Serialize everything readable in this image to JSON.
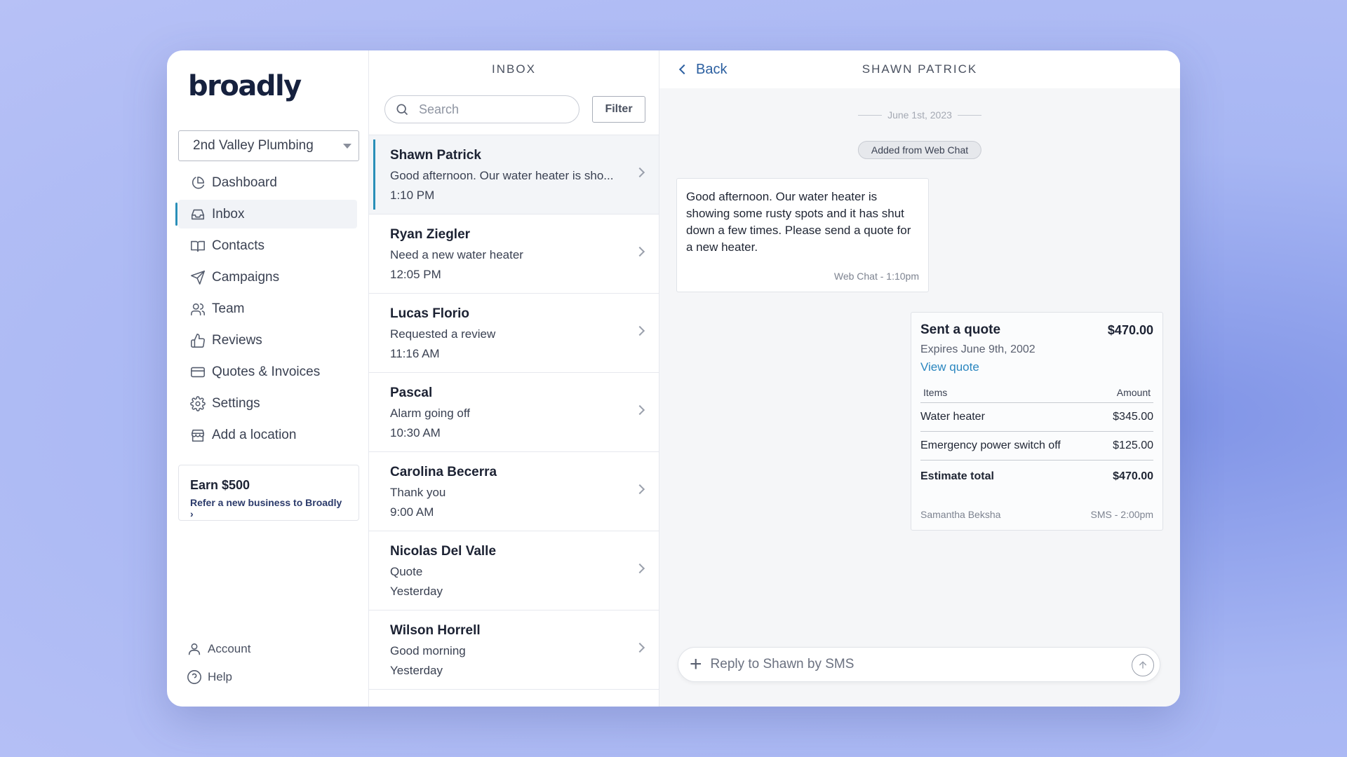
{
  "brand": {
    "logo_text": "broadly"
  },
  "sidebar": {
    "location": "2nd Valley Plumbing",
    "items": [
      {
        "label": "Dashboard",
        "icon": "pie-chart-icon"
      },
      {
        "label": "Inbox",
        "icon": "inbox-icon",
        "active": true
      },
      {
        "label": "Contacts",
        "icon": "book-icon"
      },
      {
        "label": "Campaigns",
        "icon": "send-icon"
      },
      {
        "label": "Team",
        "icon": "users-icon"
      },
      {
        "label": "Reviews",
        "icon": "thumbs-up-icon"
      },
      {
        "label": "Quotes & Invoices",
        "icon": "credit-card-icon"
      },
      {
        "label": "Settings",
        "icon": "gear-icon"
      },
      {
        "label": "Add a location",
        "icon": "store-icon"
      }
    ],
    "earn": {
      "title": "Earn $500",
      "link": "Refer a new business to Broadly"
    },
    "bottom": [
      {
        "label": "Account",
        "icon": "user-icon"
      },
      {
        "label": "Help",
        "icon": "help-icon"
      }
    ]
  },
  "inbox": {
    "title": "INBOX",
    "search_placeholder": "Search",
    "filter_label": "Filter",
    "conversations": [
      {
        "name": "Shawn Patrick",
        "message": "Good afternoon. Our water heater is sho...",
        "time": "1:10 PM",
        "active": true
      },
      {
        "name": "Ryan Ziegler",
        "message": "Need a new water heater",
        "time": "12:05 PM"
      },
      {
        "name": "Lucas Florio",
        "message": "Requested a review",
        "time": "11:16 AM"
      },
      {
        "name": "Pascal",
        "message": "Alarm going off",
        "time": "10:30 AM"
      },
      {
        "name": "Carolina Becerra",
        "message": "Thank you",
        "time": "9:00 AM"
      },
      {
        "name": "Nicolas Del Valle",
        "message": "Quote",
        "time": "Yesterday"
      },
      {
        "name": "Wilson Horrell",
        "message": "Good morning",
        "time": "Yesterday"
      }
    ]
  },
  "thread": {
    "back_label": "Back",
    "title": "SHAWN PATRICK",
    "date": "June 1st, 2023",
    "source_pill": "Added from Web Chat",
    "incoming": {
      "text": "Good afternoon. Our water heater is showing some rusty spots and it has shut down a few times. Please send a quote for a new heater.",
      "meta": "Web Chat - 1:10pm"
    },
    "quote": {
      "title": "Sent a quote",
      "amount": "$470.00",
      "expires": "Expires June 9th, 2002",
      "link": "View quote",
      "col_items": "Items",
      "col_amount": "Amount",
      "rows": [
        {
          "item": "Water heater",
          "amount": "$345.00"
        },
        {
          "item": "Emergency power switch off",
          "amount": "$125.00"
        }
      ],
      "total_label": "Estimate total",
      "total_amount": "$470.00",
      "sender": "Samantha Beksha",
      "meta": "SMS - 2:00pm"
    },
    "reply_placeholder": "Reply to Shawn by SMS"
  },
  "colors": {
    "accent": "#2a8fb8",
    "link": "#2a86bf",
    "background": "#a7b6f3"
  }
}
